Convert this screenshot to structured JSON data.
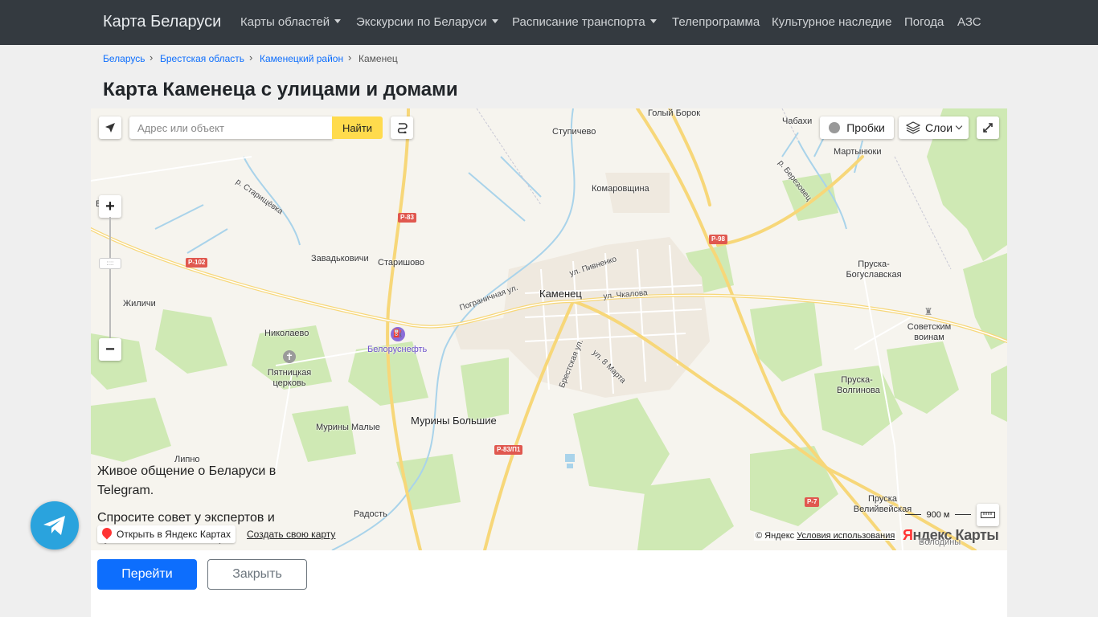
{
  "navbar": {
    "brand": "Карта Беларуси",
    "items": [
      {
        "label": "Карты областей",
        "dropdown": true
      },
      {
        "label": "Экскурсии по Беларуси",
        "dropdown": true
      },
      {
        "label": "Расписание транспорта",
        "dropdown": true
      },
      {
        "label": "Телепрограмма",
        "dropdown": false
      },
      {
        "label": "Культурное наследие",
        "dropdown": false
      },
      {
        "label": "Погода",
        "dropdown": false
      },
      {
        "label": "АЗС",
        "dropdown": false
      }
    ]
  },
  "breadcrumb": [
    "Беларусь",
    "Брестская область",
    "Каменецкий район",
    "Каменец"
  ],
  "page_title": "Карта Каменеца с улицами и домами",
  "map": {
    "search_placeholder": "Адрес или объект",
    "find_label": "Найти",
    "traffic_label": "Пробки",
    "layers_label": "Слои",
    "zoom_in": "+",
    "zoom_out": "−",
    "zoom_handle": "::::",
    "telegram_text_1": "Живое общение о Беларуси в Telegram.",
    "telegram_text_2": "Спросите совет у экспертов и путешественников! ;)",
    "open_yandex": "Открыть в Яндекс Картах",
    "create_map": "Создать свою карту",
    "copyright_prefix": "© Яндекс",
    "terms": "Условия использования",
    "logo_first": "Я",
    "logo_rest": "ндекс Карты",
    "scale_label": "900 м",
    "labels": {
      "golyi_borok": "Голый Борок",
      "chabakhi": "Чабахи",
      "stupichevo": "Ступичево",
      "martynyuki": "Мартынюки",
      "komarovshchina": "Комаровщина",
      "river_staryshevka": "р. Старищёвка",
      "river_berezovets": "р. Березовец",
      "zavadkovichi": "Завадьковичи",
      "starishovo": "Старишово",
      "kamenets": "Каменец",
      "ul_pivnenko": "ул. Пивненко",
      "ul_chkalova": "ул. Чкалова",
      "pogranichnaya": "Пограничная ул.",
      "ul_8_marta": "ул. 8 Марта",
      "brestskaya_ul": "Брестская ул.",
      "zhilichi": "Жиличи",
      "nikolaevo": "Николаево",
      "pyatnitskaya": "Пятницкая церковь",
      "belorusneft": "Белоруснефть",
      "pruska_boguslavskaya": "Пруска-Богуславская",
      "sovetskim_voinam": "Советским воинам",
      "pruska_volginova": "Пруска-Волгинова",
      "muriny_bolshie": "Мурины Большие",
      "muriny_malye": "Мурины Малые",
      "lipno": "Липно",
      "radost": "Радость",
      "pruska_veliveiskaya": "Пруска Велийвейская",
      "volodyny": "Володины",
      "edge_v": "В"
    },
    "road_badges": {
      "r83": "Р-83",
      "r102": "Р-102",
      "r98": "Р-98",
      "r83p1": "Р-83/П1",
      "r7": "Р-7"
    }
  },
  "buttons": {
    "go": "Перейти",
    "close": "Закрыть"
  }
}
